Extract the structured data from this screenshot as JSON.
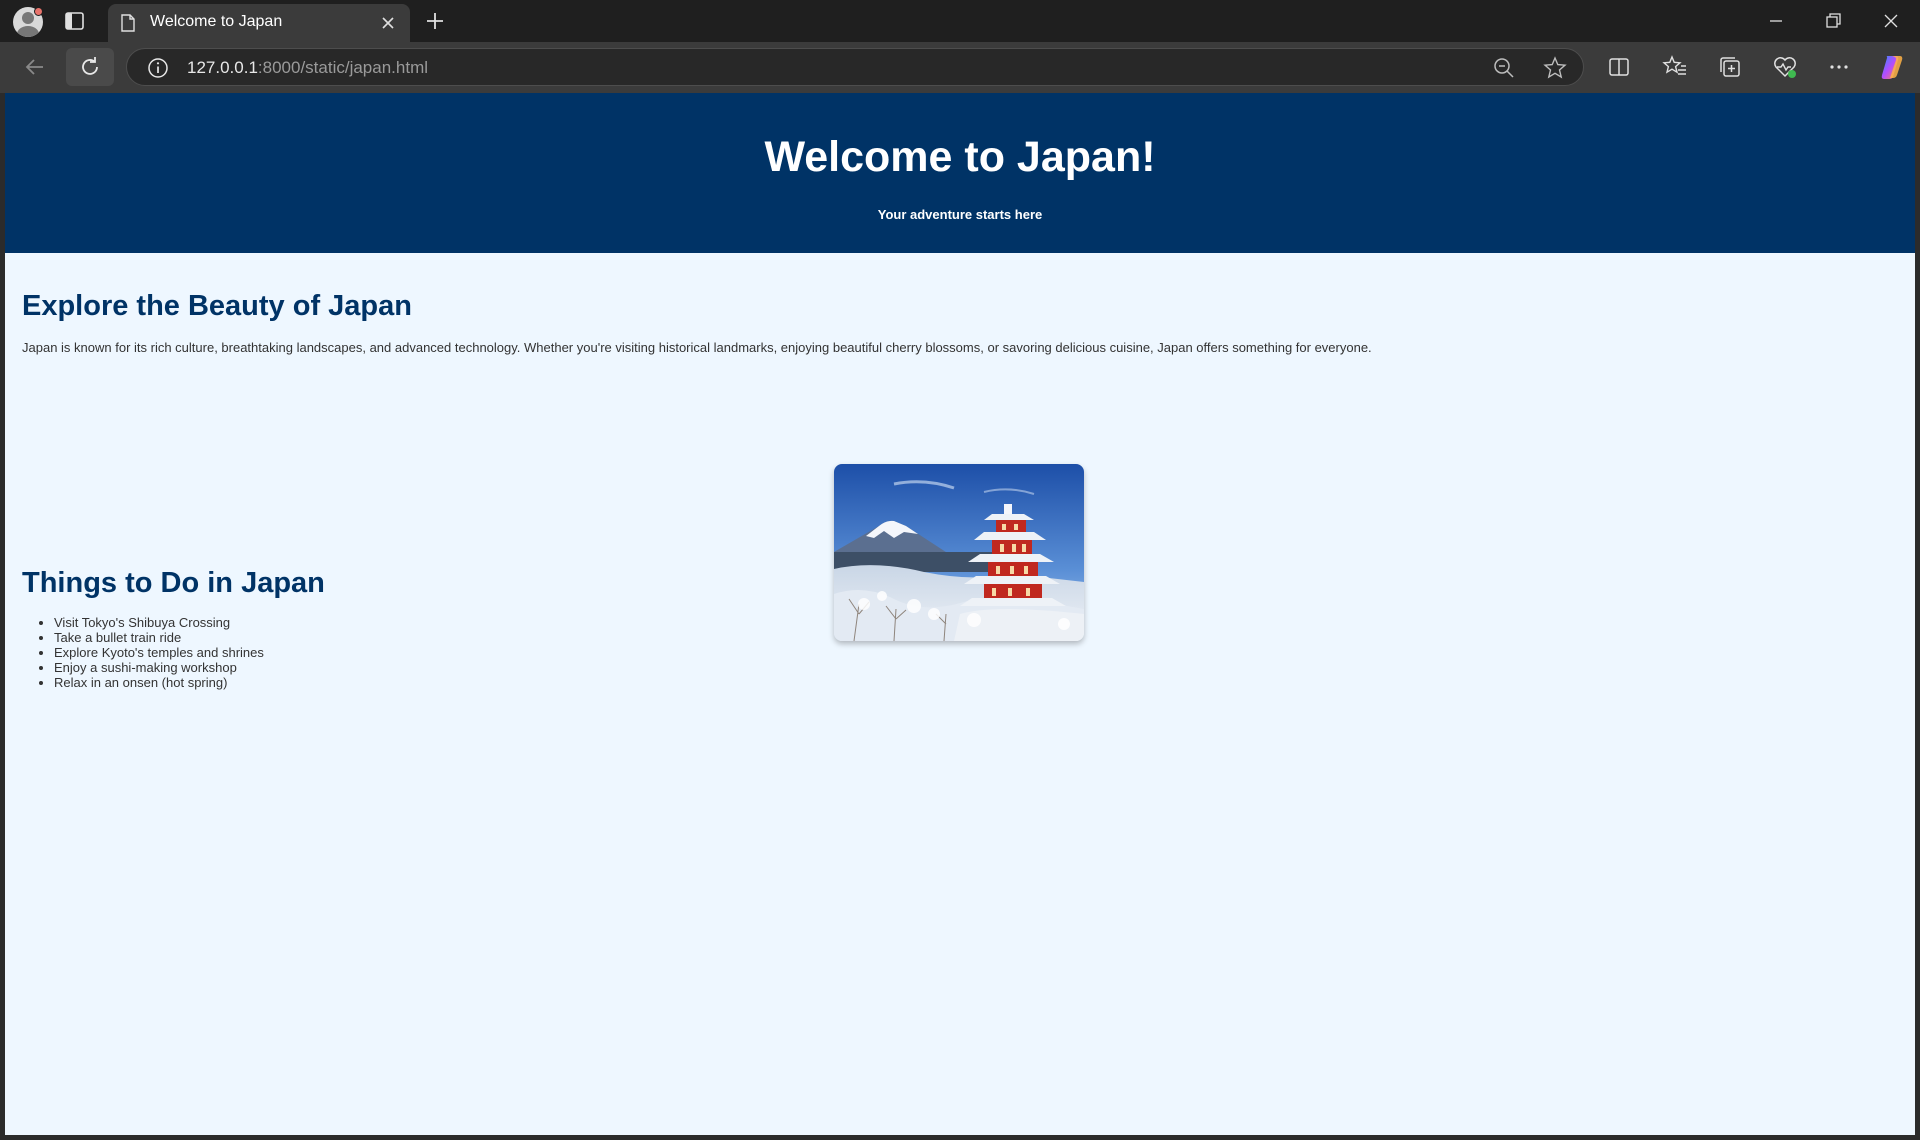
{
  "browser": {
    "tab_title": "Welcome to Japan",
    "url_host": "127.0.0.1",
    "url_rest": ":8000/static/japan.html"
  },
  "page": {
    "hero_title": "Welcome to Japan!",
    "hero_subtitle": "Your adventure starts here",
    "section1_title": "Explore the Beauty of Japan",
    "section1_text": "Japan is known for its rich culture, breathtaking landscapes, and advanced technology. Whether you're visiting historical landmarks, enjoying beautiful cherry blossoms, or savoring delicious cuisine, Japan offers something for everyone.",
    "section2_title": "Things to Do in Japan",
    "todo_items": [
      "Visit Tokyo's Shibuya Crossing",
      "Take a bullet train ride",
      "Explore Kyoto's temples and shrines",
      "Enjoy a sushi-making workshop",
      "Relax in an onsen (hot spring)"
    ]
  },
  "colors": {
    "header_bg": "#003366",
    "page_bg": "#eef7ff",
    "heading": "#003366"
  }
}
